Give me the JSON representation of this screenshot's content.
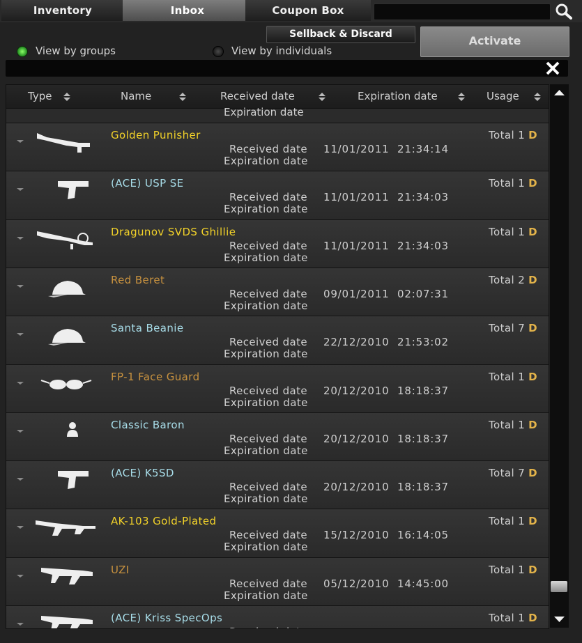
{
  "tabs": [
    {
      "label": "Inventory"
    },
    {
      "label": "Inbox"
    },
    {
      "label": "Coupon Box"
    }
  ],
  "toolbar": {
    "sellback_label": "Sellback & Discard",
    "activate_label": "Activate"
  },
  "view": {
    "by_groups": "View by groups",
    "by_individuals": "View by individuals",
    "selected": "View by groups"
  },
  "columns": [
    {
      "label": "Type"
    },
    {
      "label": "Name"
    },
    {
      "label": "Received date"
    },
    {
      "label": "Expiration date"
    },
    {
      "label": "Usage"
    }
  ],
  "partial_row": {
    "expiration_label": "Expiration date"
  },
  "labels": {
    "received": "Received date",
    "expiration": "Expiration date",
    "usage_total": "Total",
    "usage_unit": "D"
  },
  "colors": {
    "gold": "#f2d229",
    "cyan": "#a8dde9",
    "orange": "#c8923f",
    "unit": "#e3b34a"
  },
  "items": [
    {
      "name": "Golden Punisher",
      "name_color": "gold",
      "icon": "shotgun-icon",
      "received": "11/01/2011  21:34:14",
      "total": "1"
    },
    {
      "name": "(ACE) USP SE",
      "name_color": "cyan",
      "icon": "pistol-icon",
      "received": "11/01/2011  21:34:03",
      "total": "1"
    },
    {
      "name": "Dragunov SVDS Ghillie",
      "name_color": "gold",
      "icon": "sniper-rifle-icon",
      "received": "11/01/2011  21:34:03",
      "total": "1"
    },
    {
      "name": "Red Beret",
      "name_color": "orange",
      "icon": "cap-icon",
      "received": "09/01/2011  02:07:31",
      "total": "2"
    },
    {
      "name": "Santa Beanie",
      "name_color": "cyan",
      "icon": "cap-icon",
      "received": "22/12/2010  21:53:02",
      "total": "7"
    },
    {
      "name": "FP-1 Face Guard",
      "name_color": "orange",
      "icon": "goggles-icon",
      "received": "20/12/2010  18:18:37",
      "total": "1"
    },
    {
      "name": "Classic Baron",
      "name_color": "cyan",
      "icon": "character-icon",
      "received": "20/12/2010  18:18:37",
      "total": "1"
    },
    {
      "name": "(ACE) K5SD",
      "name_color": "cyan",
      "icon": "pistol-icon",
      "received": "20/12/2010  18:18:37",
      "total": "7"
    },
    {
      "name": "AK-103 Gold-Plated",
      "name_color": "gold",
      "icon": "assault-rifle-icon",
      "received": "15/12/2010  16:14:05",
      "total": "1"
    },
    {
      "name": "UZI",
      "name_color": "orange",
      "icon": "smg-icon",
      "received": "05/12/2010  14:45:00",
      "total": "1"
    },
    {
      "name": "(ACE) Kriss SpecOps",
      "name_color": "cyan",
      "icon": "smg-icon",
      "received": "",
      "total": "1"
    }
  ],
  "scrollbar": {
    "position": 0.93
  }
}
